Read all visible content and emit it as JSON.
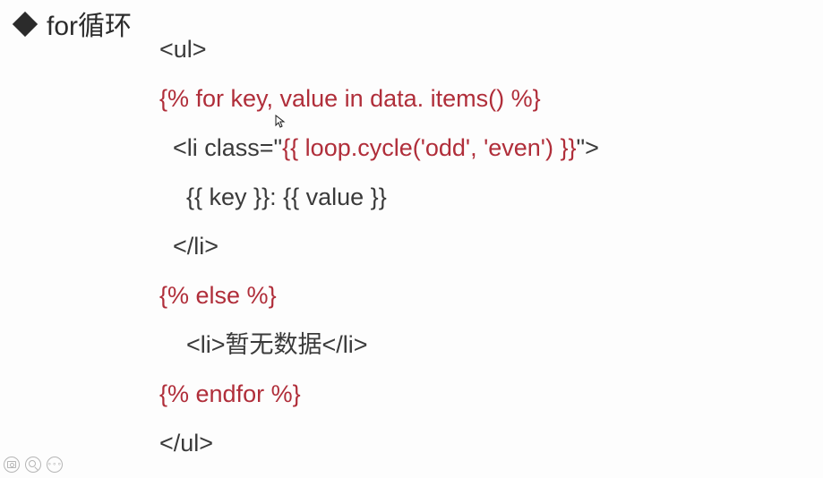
{
  "heading": "for循环",
  "code": {
    "line1": "<ul>",
    "line2": "{% for key, value in data. items() %}",
    "line3_a": "  <li class=\"",
    "line3_b": "{{ loop.cycle('odd', 'even') }}",
    "line3_c": "\">",
    "line4": "    {{ key }}: {{ value }}",
    "line5": "  </li>",
    "line6": "{% else %}",
    "line7": "    <li>暂无数据</li>",
    "line8": "{% endfor %}",
    "line9": "</ul>"
  },
  "icons": {
    "dots": "∘∘∘"
  }
}
